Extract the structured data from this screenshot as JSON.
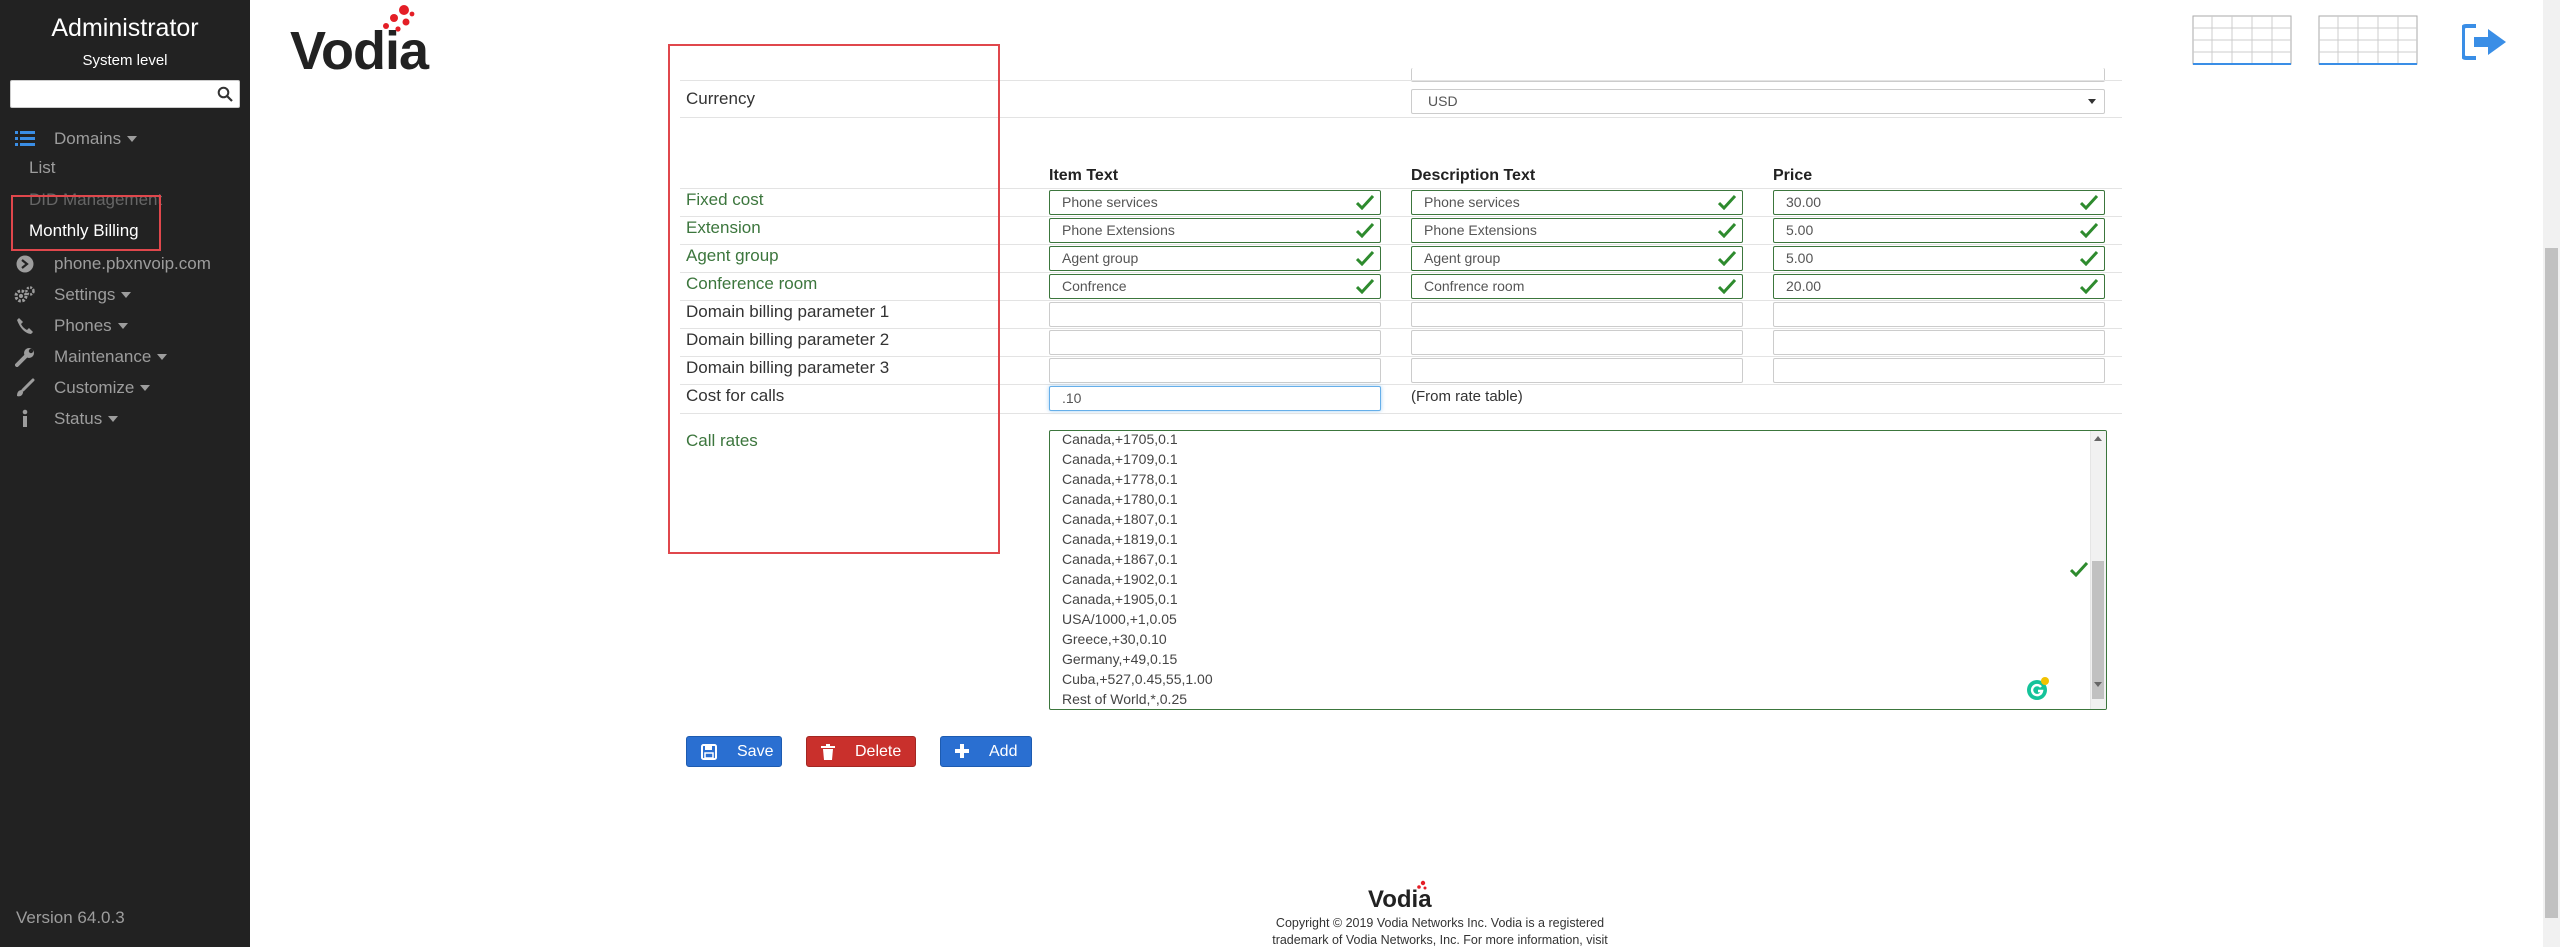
{
  "sidebar": {
    "title": "Administrator",
    "subtitle": "System level",
    "search_placeholder": "",
    "domains_label": "Domains",
    "list_label": "List",
    "did_label": "DID Management",
    "billing_label": "Monthly Billing",
    "domain_name": "phone.pbxnvoip.com",
    "settings_label": "Settings",
    "phones_label": "Phones",
    "maintenance_label": "Maintenance",
    "customize_label": "Customize",
    "status_label": "Status",
    "version": "Version 64.0.3"
  },
  "header": {
    "logo": "Vodia"
  },
  "form": {
    "currency_label": "Currency",
    "currency_value": "USD",
    "col_item": "Item Text",
    "col_desc": "Description Text",
    "col_price": "Price",
    "rows": [
      {
        "label": "Fixed cost",
        "item": "Phone services",
        "desc": "Phone services",
        "price": "30.00"
      },
      {
        "label": "Extension",
        "item": "Phone Extensions",
        "desc": "Phone Extensions",
        "price": "5.00"
      },
      {
        "label": "Agent group",
        "item": "Agent group",
        "desc": "Agent group",
        "price": "5.00"
      },
      {
        "label": "Conference room",
        "item": "Confrence",
        "desc": "Confrence room",
        "price": "20.00"
      },
      {
        "label": "Domain billing parameter 1",
        "item": "",
        "desc": "",
        "price": ""
      },
      {
        "label": "Domain billing parameter 2",
        "item": "",
        "desc": "",
        "price": ""
      },
      {
        "label": "Domain billing parameter 3",
        "item": "",
        "desc": "",
        "price": ""
      }
    ],
    "cost_calls_label": "Cost for calls",
    "cost_calls_value": ".10",
    "cost_calls_note": "(From rate table)",
    "call_rates_label": "Call rates",
    "call_rates_lines": [
      "Canada,+1705,0.1",
      "Canada,+1709,0.1",
      "Canada,+1778,0.1",
      "Canada,+1780,0.1",
      "Canada,+1807,0.1",
      "Canada,+1819,0.1",
      "Canada,+1867,0.1",
      "Canada,+1902,0.1",
      "Canada,+1905,0.1",
      "USA/1000,+1,0.05",
      "Greece,+30,0.10",
      "Germany,+49,0.15",
      "Cuba,+527,0.45,55,1.00",
      "Rest of World,*,0.25"
    ]
  },
  "buttons": {
    "save": "Save",
    "delete": "Delete",
    "add": "Add"
  },
  "footer": {
    "logo": "Vodia",
    "line1": "Copyright © 2019 Vodia Networks Inc. Vodia is a registered",
    "line2": "trademark of Vodia Networks, Inc. For more information, visit"
  }
}
